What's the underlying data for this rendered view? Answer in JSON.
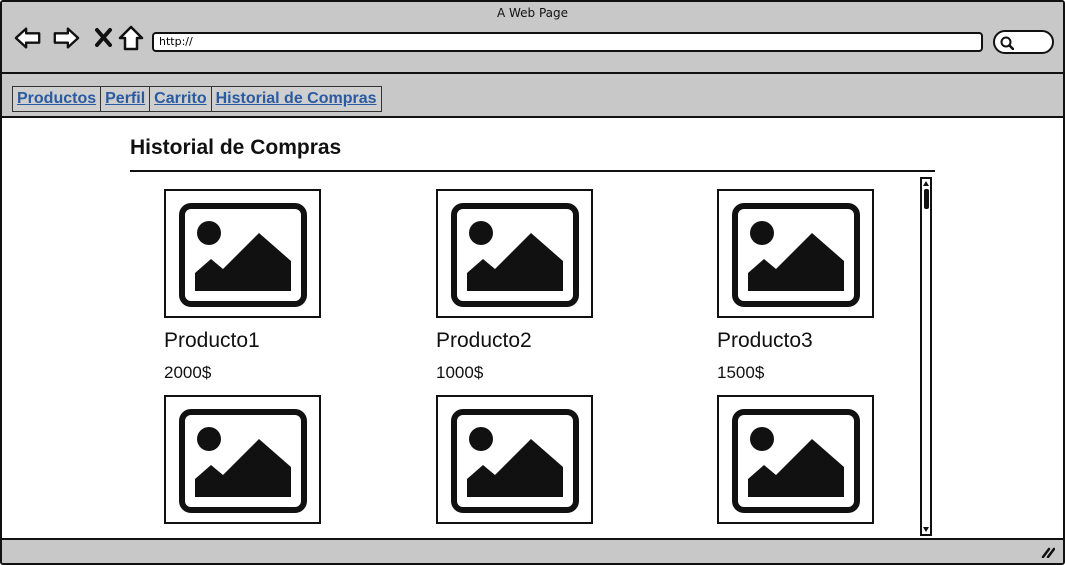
{
  "window": {
    "title": "A Web Page"
  },
  "browser": {
    "url": "http://",
    "back_icon": "back-arrow-icon",
    "forward_icon": "forward-arrow-icon",
    "stop_icon": "close-icon",
    "home_icon": "home-icon",
    "search_icon": "search-icon"
  },
  "nav": {
    "tabs": [
      {
        "label": "Productos"
      },
      {
        "label": "Perfil"
      },
      {
        "label": "Carrito"
      },
      {
        "label": "Historial de Compras"
      }
    ]
  },
  "main": {
    "title": "Historial de Compras",
    "products": [
      {
        "name": "Producto1",
        "price": "2000$"
      },
      {
        "name": "Producto2",
        "price": "1000$"
      },
      {
        "name": "Producto3",
        "price": "1500$"
      },
      {
        "name": "",
        "price": ""
      },
      {
        "name": "",
        "price": ""
      },
      {
        "name": "",
        "price": ""
      }
    ]
  },
  "colors": {
    "chrome": "#c8c8c8",
    "link": "#2a5aa0",
    "ink": "#111111"
  }
}
